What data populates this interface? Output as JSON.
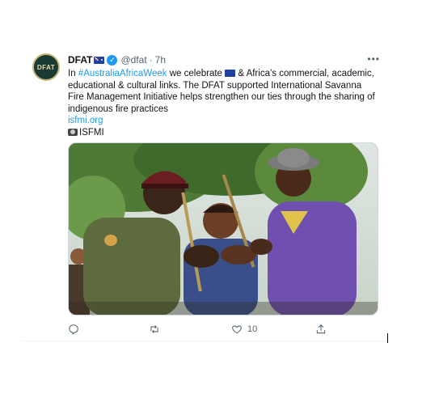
{
  "tweet": {
    "avatar_text": "DFAT",
    "display_name": "DFAT",
    "handle": "@dfat",
    "separator": "·",
    "time": "7h",
    "more_label": "•••",
    "text_parts": {
      "t1": "In ",
      "hashtag": "#AustraliaAfricaWeek",
      "t2": " we celebrate ",
      "t3": " & Africa’s commercial, academic, educational & cultural links. The DFAT supported International Savanna Fire Management Initiative helps strengthen our ties through the sharing of indigenous fire practices"
    },
    "link": "isfmi.org",
    "credit": "ISFMI",
    "photo_alt": "Three men smiling and holding fire sticks together under a tree",
    "actions": {
      "reply_count": "",
      "retweet_count": "",
      "like_count": "10"
    }
  },
  "colors": {
    "link": "#1d9bf0",
    "text": "#0f1419",
    "muted": "#536471",
    "avatar_bg": "#1b3a34"
  }
}
